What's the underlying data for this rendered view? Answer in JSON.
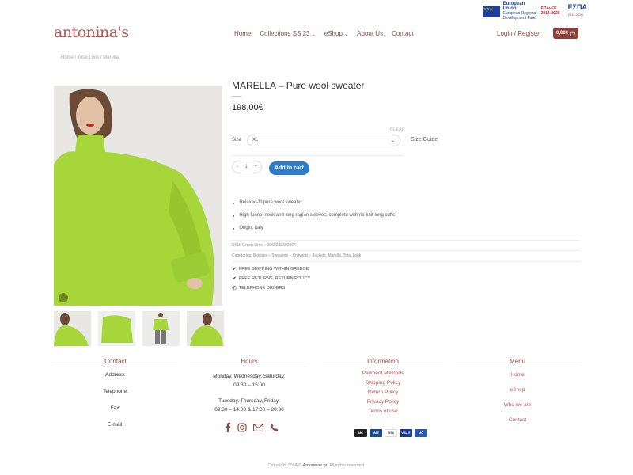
{
  "eu_banner": {
    "eu_title": "European Union",
    "eu_sub": "European Regional Development Fund",
    "epanek": "ΕΠΑνΕΚ 2014-2020",
    "espa": "ΕΣΠΑ",
    "espa_years": "2014-2020"
  },
  "brand": {
    "logo": "antonina's"
  },
  "nav": {
    "items": [
      "Home",
      "Collections SS 23",
      "eShop",
      "About Us",
      "Contact"
    ],
    "login": "Login / Register",
    "cart_total": "0,00€"
  },
  "breadcrumb": "Home / Total Look / Marella",
  "product": {
    "title": "MARELLA – Pure wool sweater",
    "price": "198,00€",
    "clear_label": "CLEAR",
    "size_label": "Size",
    "size_value": "XL",
    "size_guide": "Size Guide",
    "qty": "1",
    "qty_minus": "-",
    "qty_plus": "+",
    "add_to_cart": "Add to cart",
    "bullets": [
      "Relaxed-fit pure wool sweater",
      "High funnel neck and long raglan sleeves, complete with rib-knit long cuffs",
      "Origin: Italy"
    ],
    "sku": "SKU: Green Lime – 3068232602004",
    "categories": "Categories: Blouses – Sweaters – Knitwear – Jackets, Marella, Total Look",
    "perks": [
      "FREE SHIPPING WITHIN GREECE",
      "FREE RETURNS, RETURN POLICY",
      "TELEPHONE ORDERS"
    ]
  },
  "footer": {
    "contact": {
      "title": "Contact",
      "items": [
        "Address:",
        "Telephone:",
        "Fax:",
        "E-mail:"
      ]
    },
    "hours": {
      "title": "Hours",
      "line1": "Monday, Wednesday, Saturday:",
      "line2": "09:30 – 15:00",
      "line3": "Tuesday, Thursday, Friday:",
      "line4": "09:30 – 14:00 & 17:00 – 20:30"
    },
    "information": {
      "title": "Information",
      "items": [
        "Payment Methods",
        "Shipping Policy",
        "Return Policy",
        "Privacy Policy",
        "Terms of use"
      ]
    },
    "menu": {
      "title": "Menu",
      "items": [
        "Home",
        "eShop",
        "Who we are",
        "Contact"
      ]
    },
    "payments": [
      "MC",
      "MAE",
      "VISA",
      "VISA E",
      "MC"
    ],
    "copyright_prefix": "Copyright 2024 ©",
    "copyright_brand": "Antoninas.gr",
    "copyright_suffix": ". All rights reserved."
  },
  "colors": {
    "brand": "#b4544f",
    "cart": "#8d3f38",
    "button": "#2e7bc6",
    "sweater": "#a6d63a"
  }
}
